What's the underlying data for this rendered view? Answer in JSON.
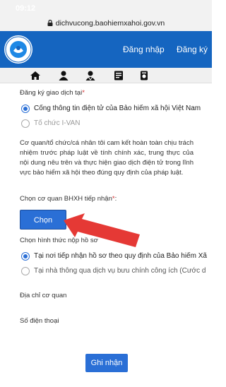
{
  "status": {
    "time": "09:12"
  },
  "browser": {
    "url": "dichvucong.baohiemxahoi.gov.vn"
  },
  "header": {
    "login_label": "Đăng nhập",
    "register_label": "Đăng ký"
  },
  "colors": {
    "primary": "#1565c0",
    "button": "#2a6fd6",
    "required": "#d32f2f",
    "arrow": "#e53935"
  },
  "toolbar_icons": [
    "home-icon",
    "user-icon",
    "support-user-icon",
    "document-icon",
    "info-icon"
  ],
  "form": {
    "register_at_label": "Đăng ký giao dịch tại",
    "register_options": [
      {
        "label": "Cổng thông tin điện tử của Bảo hiểm xã hội Việt Nam",
        "checked": true
      },
      {
        "label": "Tổ chức I-VAN",
        "checked": false
      }
    ],
    "commitment_text": "Cơ quan/tổ chức/cá nhân tôi cam kết hoàn toàn chịu trách nhiệm trước pháp luật về tính chính xác, trung thực của nội dung nêu trên và thực hiện giao dịch điện tử trong lĩnh vực bảo hiểm xã hội theo đúng quy định của pháp luật.",
    "agency_label": "Chọn cơ quan BHXH tiếp nhận",
    "choose_button": "Chọn",
    "submit_method_label": "Chọn hình thức nộp hồ sơ",
    "submit_options": [
      {
        "label": "Tại nơi tiếp nhận hồ sơ theo quy định của Bảo hiểm Xã",
        "checked": true
      },
      {
        "label": "Tại nhà thông qua dịch vụ bưu chính công ích (Cước d",
        "checked": false
      }
    ],
    "agency_address_label": "Địa chỉ cơ quan",
    "phone_label": "Số điện thoại",
    "submit_button": "Ghi nhận"
  }
}
